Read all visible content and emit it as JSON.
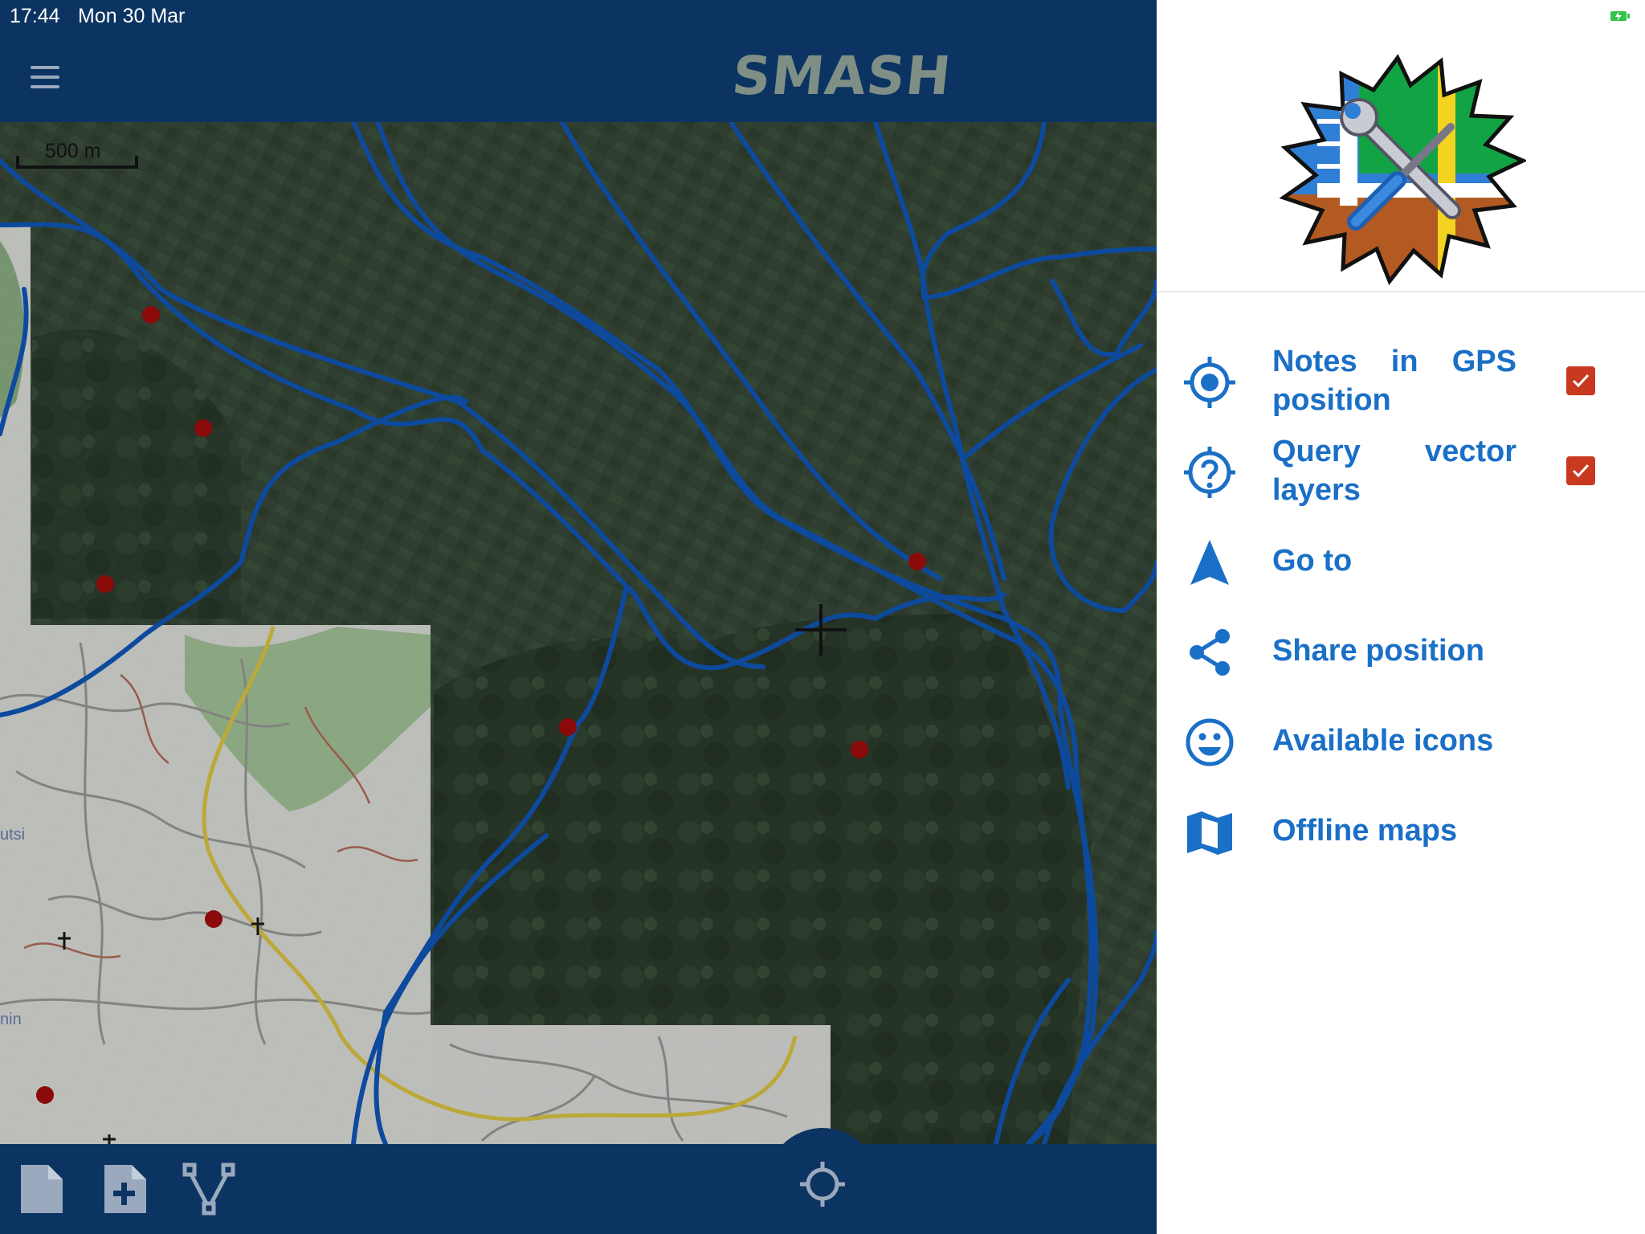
{
  "status_bar": {
    "time": "17:44",
    "date": "Mon 30 Mar"
  },
  "app_bar": {
    "title": "SMASH"
  },
  "map": {
    "scale_label": "500 m",
    "map_labels": [
      "utsi",
      "nin"
    ]
  },
  "drawer": {
    "items": [
      {
        "icon": "gps-target-icon",
        "label": "Notes in GPS position",
        "checked": true
      },
      {
        "icon": "query-help-icon",
        "label": "Query vector layers",
        "checked": true
      },
      {
        "icon": "navigation-arrow-icon",
        "label": "Go to"
      },
      {
        "icon": "share-icon",
        "label": "Share position"
      },
      {
        "icon": "smiley-icon",
        "label": "Available icons"
      },
      {
        "icon": "map-icon",
        "label": "Offline maps"
      }
    ]
  },
  "bottom_bar": {
    "buttons": [
      "simple-note-icon",
      "form-note-icon",
      "gps-log-icon",
      "center-on-gps-icon"
    ]
  },
  "colors": {
    "app_bar": "#0c3462",
    "drawer_accent": "#1a6fc7",
    "checkbox": "#c8391f",
    "map_lines": "#0d4a9e",
    "note_markers": "#8b0a0a"
  }
}
